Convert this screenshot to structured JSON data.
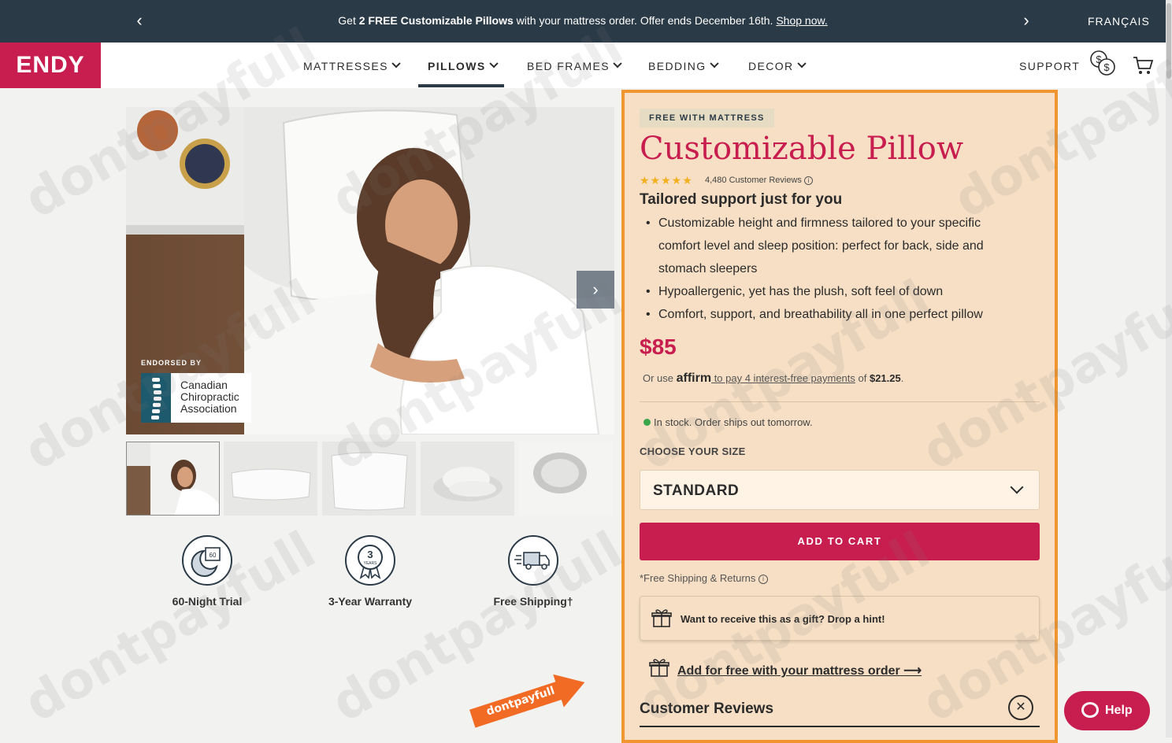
{
  "promo": {
    "prefix": "Get ",
    "bold": "2 FREE Customizable Pillows",
    "suffix": " with your mattress order. Offer ends December 16th. ",
    "link": "Shop now.",
    "language": "FRANÇAIS"
  },
  "nav": {
    "logo": "ENDY",
    "items": [
      {
        "label": "MATTRESSES"
      },
      {
        "label": "PILLOWS"
      },
      {
        "label": "BED FRAMES"
      },
      {
        "label": "BEDDING"
      },
      {
        "label": "DECOR"
      }
    ],
    "support": "SUPPORT"
  },
  "gallery": {
    "endorsed_label": "ENDORSED BY",
    "endorser_line1": "Canadian",
    "endorser_line2": "Chiropractic",
    "endorser_line3": "Association",
    "clock_text": "60"
  },
  "features": [
    {
      "label": "60-Night Trial",
      "icon": "moon-calendar-icon",
      "badge": "60"
    },
    {
      "label": "3-Year Warranty",
      "icon": "warranty-ribbon-icon",
      "badge": "3",
      "badge_sub": "YEARS"
    },
    {
      "label": "Free Shipping†",
      "icon": "truck-icon"
    }
  ],
  "product": {
    "badge": "FREE WITH MATTRESS",
    "title": "Customizable Pillow",
    "rating_stars": "★★★★★",
    "review_count": "4,480 Customer Reviews",
    "subtitle": "Tailored support just for you",
    "bullets": [
      "Customizable height and firmness tailored to your specific comfort level and sleep position: perfect for back, side and stomach sleepers",
      "Hypoallergenic, yet has the plush, soft feel of down",
      "Comfort, support, and breathability all in one perfect pillow"
    ],
    "price": "$85",
    "affirm": {
      "prefix": "Or use ",
      "brand": "affirm",
      "mid": " to pay 4 interest-free payments",
      "of": " of ",
      "amount": "$21.25",
      "end": "."
    },
    "stock": "In stock. Order ships out tomorrow.",
    "size_label": "CHOOSE YOUR SIZE",
    "size_value": "STANDARD",
    "add_to_cart": "ADD TO CART",
    "shipping_note": "*Free Shipping & Returns",
    "gift_hint": "Want to receive this as a gift? Drop a hint!",
    "add_free": "Add for free with your mattress order",
    "customer_reviews": "Customer Reviews"
  },
  "help": "Help",
  "watermark": "dontpayfull",
  "colors": {
    "brand": "#c81e4f",
    "promo_bg": "#2b3a47",
    "panel_bg": "#f6dfc4",
    "panel_border": "#f0952f"
  }
}
